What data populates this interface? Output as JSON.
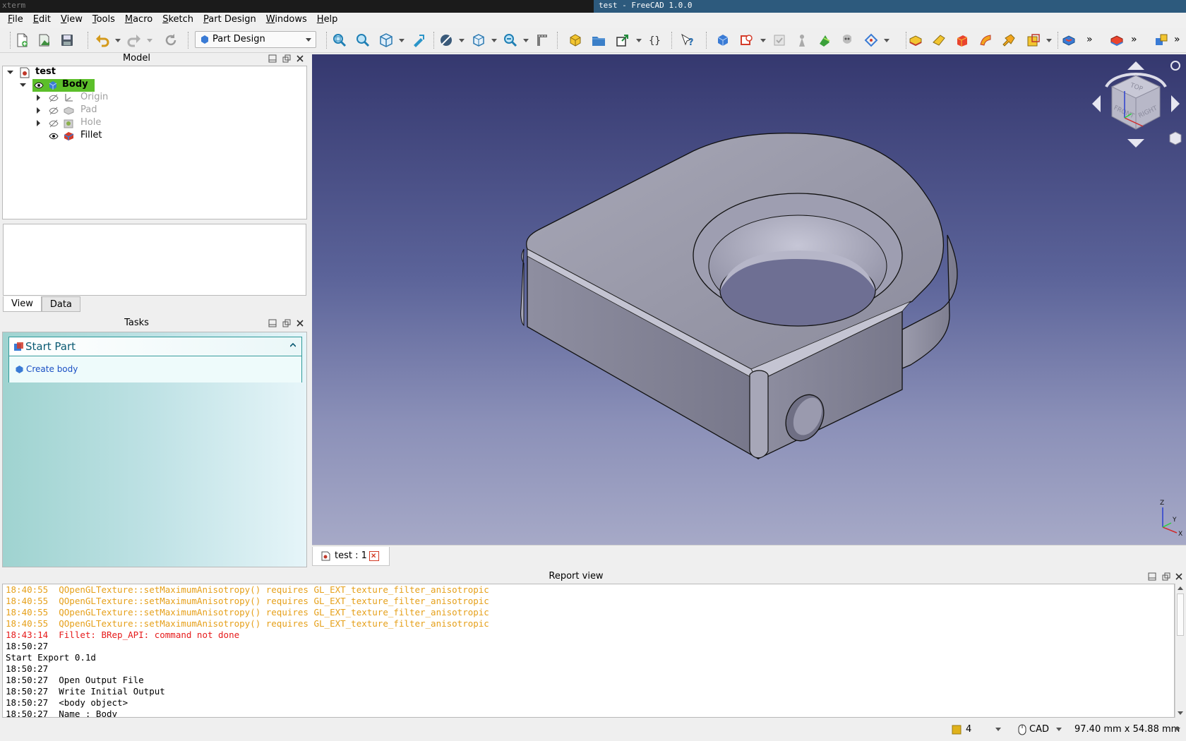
{
  "window": {
    "xterm_label": "xterm",
    "title": "test - FreeCAD 1.0.0"
  },
  "menu": [
    {
      "label": "File",
      "u": "F",
      "rest": "ile"
    },
    {
      "label": "Edit",
      "u": "E",
      "rest": "dit"
    },
    {
      "label": "View",
      "u": "V",
      "rest": "iew"
    },
    {
      "label": "Tools",
      "u": "T",
      "rest": "ools"
    },
    {
      "label": "Macro",
      "u": "M",
      "rest": "acro"
    },
    {
      "label": "Sketch",
      "u": "S",
      "rest": "ketch"
    },
    {
      "label": "Part Design",
      "u": "P",
      "rest": "art Design"
    },
    {
      "label": "Windows",
      "u": "W",
      "rest": "indows"
    },
    {
      "label": "Help",
      "u": "H",
      "rest": "elp"
    }
  ],
  "toolbar": {
    "workbench": "Part Design",
    "overflow": "»"
  },
  "model_panel": {
    "title": "Model",
    "tree": {
      "document": "test",
      "body": "Body",
      "children": [
        "Origin",
        "Pad",
        "Hole",
        "Fillet"
      ]
    }
  },
  "property_tabs": [
    "View",
    "Data"
  ],
  "tasks_panel": {
    "title": "Tasks",
    "section_title": "Start Part",
    "action": "Create body"
  },
  "document_tab": "test : 1",
  "navcube": {
    "top": "TOP",
    "front": "FRONT",
    "right": "RIGHT"
  },
  "axis_labels": {
    "x": "X",
    "y": "Y",
    "z": "Z"
  },
  "report_view": {
    "title": "Report view",
    "lines": [
      {
        "type": "warn",
        "text": "18:40:55  QOpenGLTexture::setMaximumAnisotropy() requires GL_EXT_texture_filter_anisotropic"
      },
      {
        "type": "warn",
        "text": "18:40:55  QOpenGLTexture::setMaximumAnisotropy() requires GL_EXT_texture_filter_anisotropic"
      },
      {
        "type": "warn",
        "text": "18:40:55  QOpenGLTexture::setMaximumAnisotropy() requires GL_EXT_texture_filter_anisotropic"
      },
      {
        "type": "warn",
        "text": "18:40:55  QOpenGLTexture::setMaximumAnisotropy() requires GL_EXT_texture_filter_anisotropic"
      },
      {
        "type": "err",
        "text": "18:43:14  Fillet: BRep_API: command not done"
      },
      {
        "type": "msg",
        "text": "18:50:27"
      },
      {
        "type": "msg",
        "text": "Start Export 0.1d"
      },
      {
        "type": "msg",
        "text": "18:50:27"
      },
      {
        "type": "msg",
        "text": "18:50:27  Open Output File"
      },
      {
        "type": "msg",
        "text": "18:50:27  Write Initial Output"
      },
      {
        "type": "msg",
        "text": "18:50:27  <body object>"
      },
      {
        "type": "msg",
        "text": "18:50:27  Name : Body"
      }
    ]
  },
  "status": {
    "notifications": "4",
    "nav_style": "CAD",
    "dimensions": "97.40 mm x 54.88 mm"
  },
  "colors": {
    "title_active": "#2d5a7d",
    "body_highlight": "#5cbf2a",
    "warn": "#e6a01a",
    "error": "#e61a1a",
    "task_title": "#0a5a73",
    "link": "#1a4fc4"
  }
}
